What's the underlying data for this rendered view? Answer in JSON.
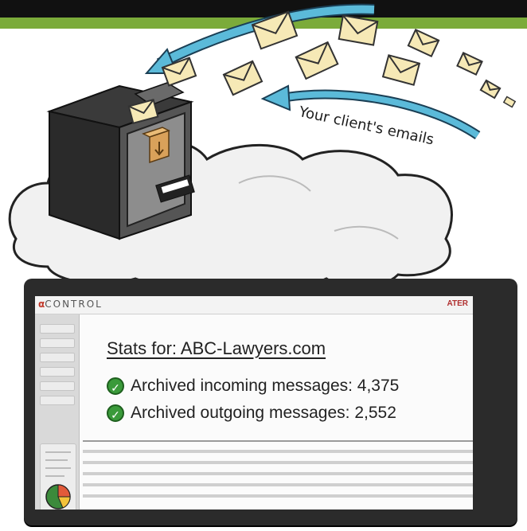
{
  "scene": {
    "caption": "Your client's emails"
  },
  "app": {
    "brand_prefix": "α",
    "brand_name": "CONTROL",
    "corner_label": "ATER"
  },
  "stats": {
    "title": "Stats for: ABC-Lawyers.com",
    "items": [
      {
        "label": "Archived incoming messages: 4,375"
      },
      {
        "label": "Archived outgoing messages: 2,552"
      }
    ]
  },
  "colors": {
    "top_bar": "#111111",
    "green_bar": "#7bab3a",
    "arrow": "#5bbad9",
    "check": "#3a9a3a",
    "envelope": "#f6e9b6"
  },
  "icons": [
    "envelope-icon",
    "arrow-icon",
    "archive-box-icon",
    "check-icon",
    "pie-chart-icon"
  ]
}
